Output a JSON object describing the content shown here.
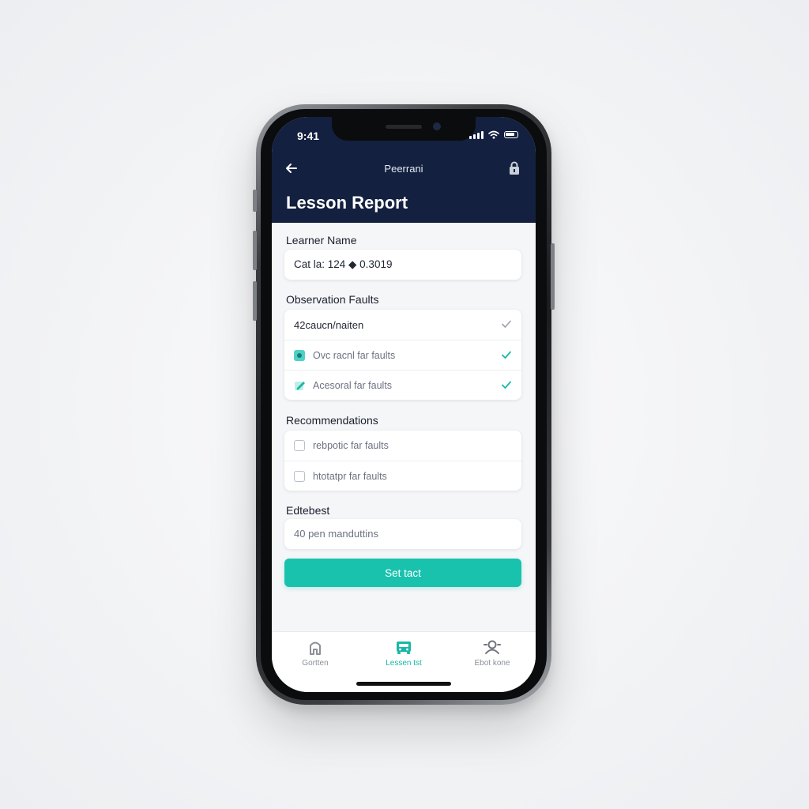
{
  "status_bar": {
    "time": "9:41"
  },
  "nav": {
    "title": "Peerrani"
  },
  "page": {
    "title": "Lesson Report"
  },
  "learner": {
    "label": "Learner Name",
    "value": "Cat la: 124 ◆ 0.3019"
  },
  "observation": {
    "label": "Observation Faults",
    "items": [
      {
        "label": "42caucn/naiten",
        "checked": true,
        "style": "plain"
      },
      {
        "label": "Ovc racnl far faults",
        "checked": true,
        "style": "teal-box"
      },
      {
        "label": "Acesoral far faults",
        "checked": true,
        "style": "pencil"
      }
    ]
  },
  "recommendations": {
    "label": "Recommendations",
    "items": [
      {
        "label": "rebpotic far faults",
        "checked": false
      },
      {
        "label": "htotatpr far faults",
        "checked": false
      }
    ]
  },
  "edtebest": {
    "label": "Edtebest",
    "placeholder": "40 pen manduttins"
  },
  "submit": {
    "label": "Set tact"
  },
  "tabs": [
    {
      "label": "Gortten",
      "icon": "home-icon",
      "active": false
    },
    {
      "label": "Lessen tst",
      "icon": "car-icon",
      "active": true
    },
    {
      "label": "Ebot kone",
      "icon": "profile-icon",
      "active": false
    }
  ],
  "colors": {
    "header": "#13203f",
    "accent": "#19c2ad",
    "background": "#f5f6f8"
  }
}
